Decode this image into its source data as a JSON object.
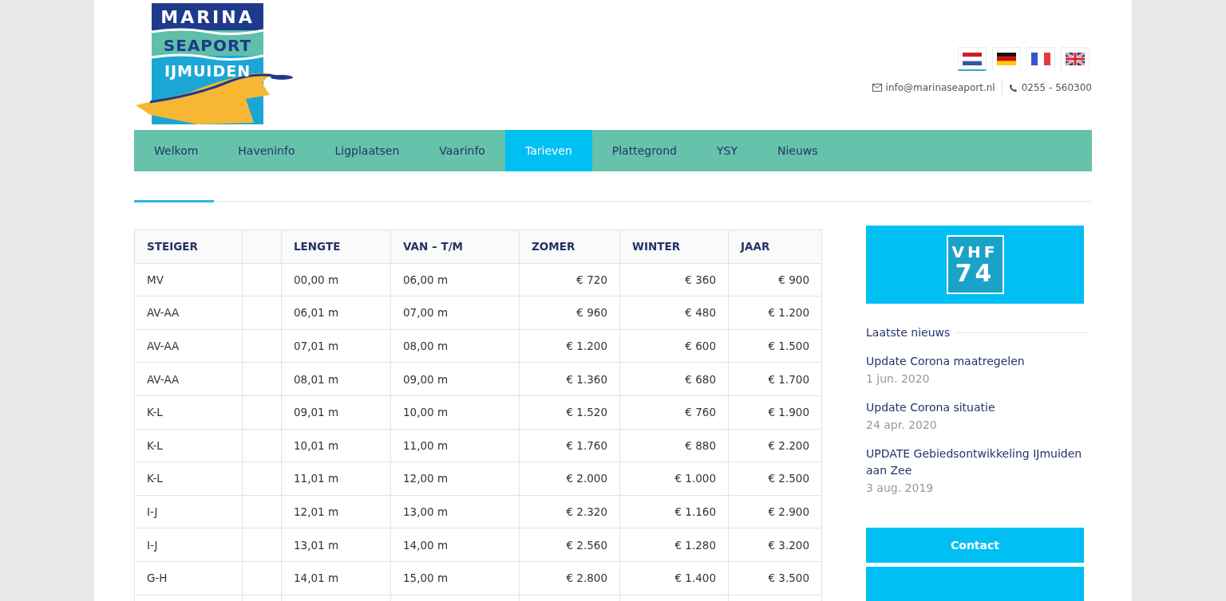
{
  "logo": {
    "lines": [
      "MARINA",
      "SEAPORT",
      "IJMUIDEN"
    ]
  },
  "languages": [
    {
      "kind": "nl",
      "selected": true
    },
    {
      "kind": "de",
      "selected": false
    },
    {
      "kind": "fr",
      "selected": false
    },
    {
      "kind": "en",
      "selected": false
    }
  ],
  "contact": {
    "email": "info@marinaseaport.nl",
    "phone": "0255 - 560300"
  },
  "nav": [
    {
      "label": "Welkom",
      "selected": false
    },
    {
      "label": "Haveninfo",
      "selected": false
    },
    {
      "label": "Ligplaatsen",
      "selected": false
    },
    {
      "label": "Vaarinfo",
      "selected": false
    },
    {
      "label": "Tarieven",
      "selected": true
    },
    {
      "label": "Plattegrond",
      "selected": false
    },
    {
      "label": "YSY",
      "selected": false
    },
    {
      "label": "Nieuws",
      "selected": false
    }
  ],
  "table": {
    "columns": [
      "STEIGER",
      "",
      "LENGTE",
      "VAN – T/M",
      "ZOMER",
      "WINTER",
      "JAAR"
    ],
    "rows": [
      [
        "MV",
        "",
        "00,00 m",
        "06,00 m",
        "€ 720",
        "€ 360",
        "€ 900"
      ],
      [
        "AV-AA",
        "",
        "06,01 m",
        "07,00 m",
        "€ 960",
        "€ 480",
        "€ 1.200"
      ],
      [
        "AV-AA",
        "",
        "07,01 m",
        "08,00 m",
        "€ 1.200",
        "€ 600",
        "€ 1.500"
      ],
      [
        "AV-AA",
        "",
        "08,01 m",
        "09,00 m",
        "€ 1.360",
        "€ 680",
        "€ 1.700"
      ],
      [
        "K-L",
        "",
        "09,01 m",
        "10,00 m",
        "€ 1.520",
        "€ 760",
        "€ 1.900"
      ],
      [
        "K-L",
        "",
        "10,01 m",
        "11,00 m",
        "€ 1.760",
        "€ 880",
        "€ 2.200"
      ],
      [
        "K-L",
        "",
        "11,01 m",
        "12,00 m",
        "€ 2.000",
        "€ 1.000",
        "€ 2.500"
      ],
      [
        "I-J",
        "",
        "12,01 m",
        "13,00 m",
        "€ 2.320",
        "€ 1.160",
        "€ 2.900"
      ],
      [
        "I-J",
        "",
        "13,01 m",
        "14,00 m",
        "€ 2.560",
        "€ 1.280",
        "€ 3.200"
      ],
      [
        "G-H",
        "",
        "14,01 m",
        "15,00 m",
        "€ 2.800",
        "€ 1.400",
        "€ 3.500"
      ],
      [
        "",
        "",
        "",
        "",
        "",
        "",
        ""
      ]
    ]
  },
  "sidebar": {
    "vhf": {
      "line1": "VHF",
      "line2": "74"
    },
    "news_title": "Laatste nieuws",
    "news": [
      {
        "title": "Update Corona maatregelen",
        "date": "1 jun. 2020"
      },
      {
        "title": "Update Corona situatie",
        "date": "24 apr. 2020"
      },
      {
        "title": "UPDATE Gebiedsontwikkeling IJmuiden aan Zee",
        "date": "3 aug. 2019"
      }
    ],
    "buttons": [
      {
        "kind": "labelled",
        "label": "Contact"
      },
      {
        "kind": "cut"
      }
    ]
  }
}
